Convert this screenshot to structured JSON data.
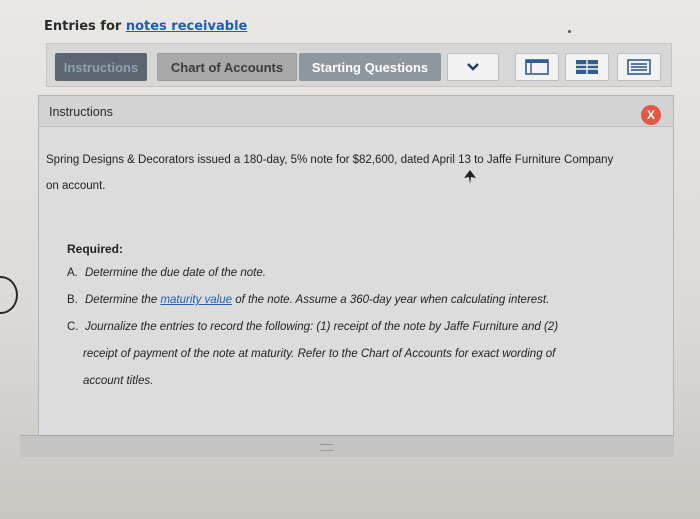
{
  "header": {
    "prefix": "Entries for ",
    "link": "notes receivable"
  },
  "toolbar": {
    "tabs": [
      {
        "label": "Instructions"
      },
      {
        "label": "Chart of Accounts"
      },
      {
        "label": "Starting Questions"
      }
    ],
    "icons": [
      "chevron-down-icon",
      "table-icon",
      "grid-icon",
      "form-icon"
    ]
  },
  "panel": {
    "title": "Instructions",
    "close_label": "X",
    "intro_line1": "Spring Designs & Decorators issued a 180-day, 5% note for $82,600, dated April 13 to Jaffe Furniture Company",
    "intro_line2": "on account.",
    "required_label": "Required:",
    "items": [
      {
        "bullet": "A.",
        "text": "Determine the due date of the note."
      },
      {
        "bullet": "B.",
        "pre": "Determine the ",
        "link": "maturity value",
        "post": " of the note. Assume a 360-day year when calculating interest."
      },
      {
        "bullet": "C.",
        "line1": "Journalize the entries to record the following: (1) receipt of the note by Jaffe Furniture and (2)",
        "line2": "receipt of payment of the note at maturity. Refer to the Chart of Accounts for exact wording of",
        "line3": "account titles."
      }
    ]
  }
}
